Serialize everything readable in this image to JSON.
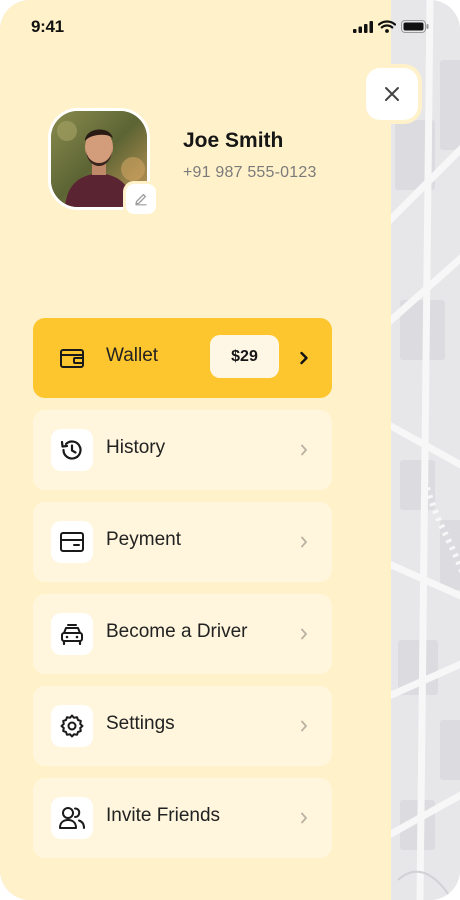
{
  "status_bar": {
    "time": "9:41"
  },
  "profile": {
    "name": "Joe Smith",
    "phone": "+91 987 555-0123"
  },
  "menu": {
    "wallet": {
      "label": "Wallet",
      "balance": "$29"
    },
    "history": {
      "label": "History"
    },
    "payment": {
      "label": "Peyment"
    },
    "driver": {
      "label": "Become a Driver"
    },
    "settings": {
      "label": "Settings"
    },
    "invite": {
      "label": "Invite Friends"
    }
  },
  "colors": {
    "drawer_bg": "#fff1c9",
    "accent": "#fdc62e",
    "item_bg": "#fff6dd",
    "map_bg": "#e9e9ec"
  },
  "icons": {
    "close": "close-icon",
    "edit": "pencil-icon",
    "wallet": "wallet-icon",
    "history": "history-icon",
    "payment": "card-icon",
    "driver": "car-icon",
    "settings": "gear-icon",
    "invite": "users-icon"
  }
}
